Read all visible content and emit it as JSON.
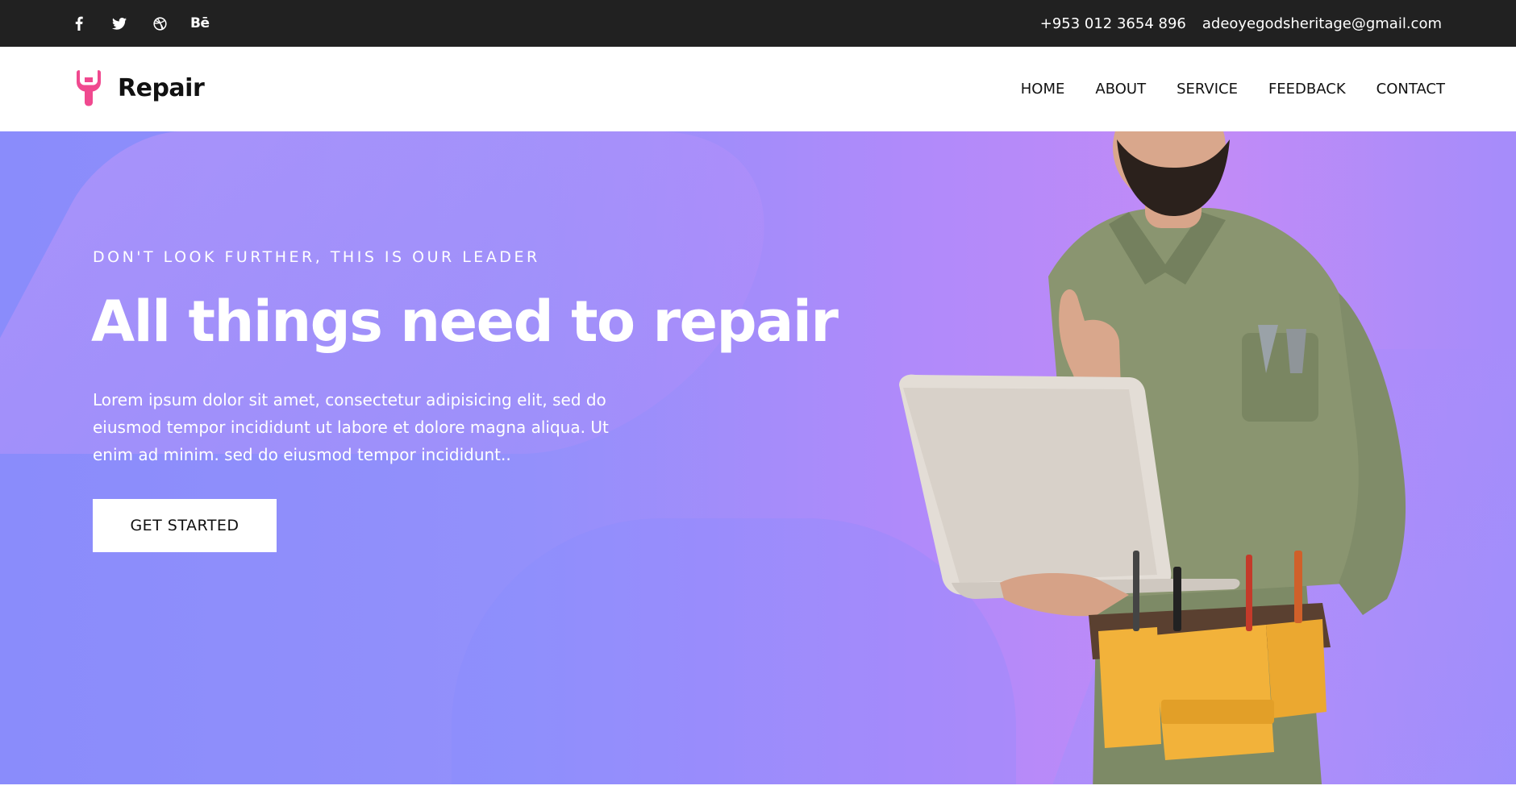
{
  "topbar": {
    "social": [
      {
        "icon": "facebook-icon"
      },
      {
        "icon": "twitter-icon"
      },
      {
        "icon": "dribbble-icon"
      },
      {
        "icon": "behance-icon",
        "label": "Bē"
      }
    ],
    "phone": "+953 012 3654 896",
    "email": "adeoyegodsheritage@gmail.com"
  },
  "header": {
    "logo_text": "Repair",
    "logo_color": "#f0498f",
    "nav": [
      {
        "label": "HOME"
      },
      {
        "label": "ABOUT"
      },
      {
        "label": "SERVICE"
      },
      {
        "label": "FEEDBACK"
      },
      {
        "label": "CONTACT"
      }
    ]
  },
  "hero": {
    "eyebrow": "DON'T LOOK FURTHER, THIS IS OUR LEADER",
    "headline": "All things need to repair",
    "description": "Lorem ipsum dolor sit amet, consectetur adipisicing elit, sed do eiusmod tempor incididunt ut labore et dolore magna aliqua. Ut enim ad minim. sed do eiusmod tempor incididunt..",
    "cta_label": "GET STARTED",
    "gradient_start": "#8a8cfb",
    "gradient_end": "#c28bf7"
  }
}
